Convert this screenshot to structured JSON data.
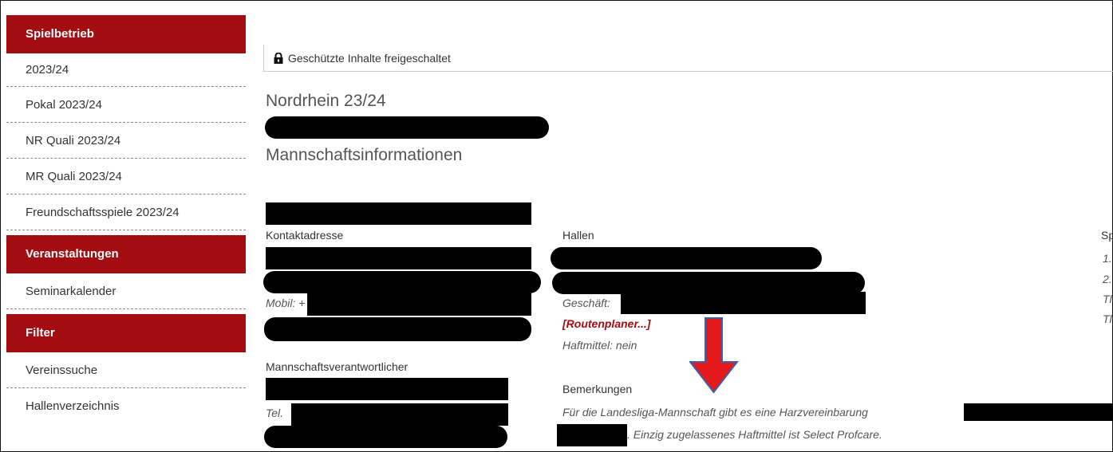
{
  "sidebar": {
    "sections": [
      {
        "title": "Spielbetrieb",
        "items": [
          "2023/24",
          "Pokal 2023/24",
          "NR Quali 2023/24",
          "MR Quali 2023/24",
          "Freundschaftsspiele 2023/24"
        ]
      },
      {
        "title": "Veranstaltungen",
        "items": [
          "Seminarkalender"
        ]
      },
      {
        "title": "Filter",
        "items": [
          "Vereinssuche",
          "Hallenverzeichnis"
        ]
      }
    ]
  },
  "main": {
    "unlock_text": "Geschützte Inhalte freigeschaltet",
    "league_title": "Nordrhein 23/24",
    "page_title": "Mannschaftsinformationen",
    "contact": {
      "label": "Kontaktadresse",
      "mobile_prefix": "Mobil: +"
    },
    "responsible": {
      "label": "Mannschaftsverantwortlicher",
      "tel_prefix": "Tel."
    },
    "halls": {
      "label": "Hallen",
      "business_prefix": "Geschäft:",
      "route_link": "[Routenplaner...]",
      "resin": "Haftmittel: nein"
    },
    "remarks": {
      "label": "Bemerkungen",
      "line1": "Für die Landesliga-Mannschaft gibt es eine Harzvereinbarung",
      "line2": ". Einzig zugelassenes Haftmittel ist Select Profcare."
    },
    "right_col": {
      "label": "Sp",
      "items": [
        "1.",
        "2.",
        "Tl",
        "Tl"
      ]
    }
  },
  "colors": {
    "accent": "#a30d12",
    "arrow": "#e3191c",
    "arrow_outline": "#3a5fb0"
  },
  "icons": {
    "unlock": "padlock-icon",
    "annotation": "down-arrow-icon"
  }
}
